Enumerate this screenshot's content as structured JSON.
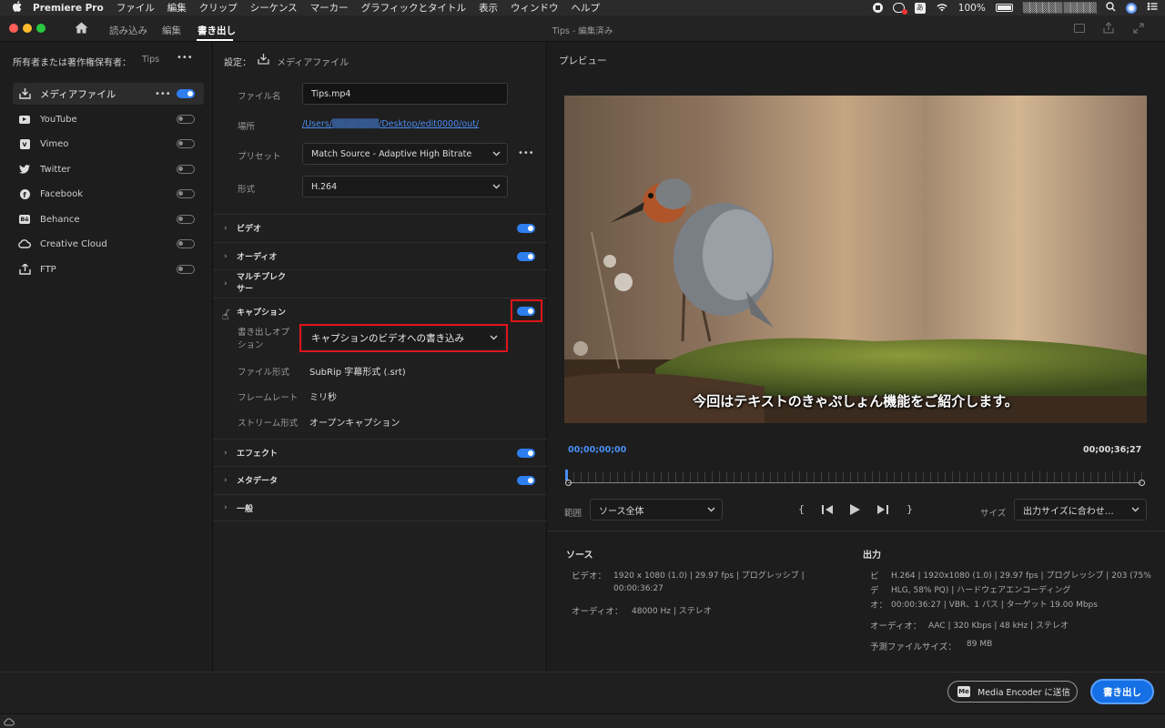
{
  "menubar": {
    "apple": "",
    "app": "Premiere Pro",
    "items": [
      "ファイル",
      "編集",
      "クリップ",
      "シーケンス",
      "マーカー",
      "グラフィックとタイトル",
      "表示",
      "ウィンドウ",
      "ヘルプ"
    ],
    "battery": "100%",
    "user": "▒▒▒▒▒▒ ▒▒▒▒▒"
  },
  "titlebar": {
    "tabs": [
      "読み込み",
      "編集",
      "書き出し"
    ],
    "project_title": "Tips - 編集済み"
  },
  "left": {
    "owner_label": "所有者または著作権保有者：",
    "owner_value": "Tips",
    "more": "•••",
    "destinations": [
      {
        "label": "メディアファイル",
        "icon": "download-icon",
        "on": true
      },
      {
        "label": "YouTube",
        "icon": "youtube-icon",
        "on": false
      },
      {
        "label": "Vimeo",
        "icon": "vimeo-icon",
        "on": false
      },
      {
        "label": "Twitter",
        "icon": "twitter-icon",
        "on": false
      },
      {
        "label": "Facebook",
        "icon": "facebook-icon",
        "on": false
      },
      {
        "label": "Behance",
        "icon": "behance-icon",
        "on": false
      },
      {
        "label": "Creative Cloud",
        "icon": "creative-cloud-icon",
        "on": false
      },
      {
        "label": "FTP",
        "icon": "upload-icon",
        "on": false
      }
    ]
  },
  "settings": {
    "header_label": "設定：",
    "header_value": "メディアファイル",
    "filename_label": "ファイル名",
    "filename_value": "Tips.mp4",
    "location_label": "場所",
    "location_value": "/Users/▒▒▒▒▒▒▒/Desktop/edit0000/out/",
    "preset_label": "プリセット",
    "preset_value": "Match Source - Adaptive High Bitrate",
    "format_label": "形式",
    "format_value": "H.264",
    "more": "•••",
    "sections": [
      {
        "label": "ビデオ",
        "on": true
      },
      {
        "label": "オーディオ",
        "on": true
      },
      {
        "label": "マルチプレクサー",
        "on": null
      },
      {
        "label": "キャプション",
        "on": true,
        "expanded": true
      },
      {
        "label": "エフェクト",
        "on": true
      },
      {
        "label": "メタデータ",
        "on": true
      },
      {
        "label": "一般",
        "on": null
      }
    ],
    "caption": {
      "export_option_label": "書き出しオプション",
      "export_option_value": "キャプションのビデオへの書き込み",
      "file_format_label": "ファイル形式",
      "file_format_value": "SubRip 字幕形式 (.srt)",
      "frame_rate_label": "フレームレート",
      "frame_rate_value": "ミリ秒",
      "stream_format_label": "ストリーム形式",
      "stream_format_value": "オープンキャプション"
    }
  },
  "preview": {
    "title": "プレビュー",
    "subtitle": "今回はテキストのきゃぷしょん機能をご紹介します。",
    "timecode_start": "00;00;00;00",
    "timecode_end": "00;00;36;27",
    "range_label": "範囲",
    "range_value": "ソース全体",
    "size_label": "サイズ",
    "size_value": "出力サイズに合わせ…",
    "controls": [
      "{",
      "⏮",
      "▶",
      "⏭",
      "}"
    ]
  },
  "info": {
    "source_title": "ソース",
    "source_video_label": "ビデオ：",
    "source_video_value": "1920 x 1080 (1.0) | 29.97 fps | プログレッシブ |",
    "source_video_value2": "00:00:36:27",
    "source_audio_label": "オーディオ：",
    "source_audio_value": "48000 Hz | ステレオ",
    "output_title": "出力",
    "out_video_label1": "ビ",
    "out_video_label2": "デ",
    "out_video_label3": "オ：",
    "out_video_line1": "H.264 | 1920x1080 (1.0) | 29.97 fps | プログレッシブ | 203 (75%",
    "out_video_line2": "HLG, 58% PQ) | ハードウェアエンコーディング",
    "out_video_line3": "00:00:36:27 | VBR、1 パス | ターゲット 19.00 Mbps",
    "out_audio_label": "オーディオ：",
    "out_audio_value": "AAC | 320 Kbps | 48 kHz | ステレオ",
    "est_size_label": "予測ファイルサイズ：",
    "est_size_value": "89 MB"
  },
  "footer": {
    "media_encoder_label": "Media Encoder に送信",
    "me_badge": "Me",
    "export_label": "書き出し"
  },
  "colors": {
    "accent": "#2e7ef0",
    "highlight_box": "#e0141a"
  }
}
